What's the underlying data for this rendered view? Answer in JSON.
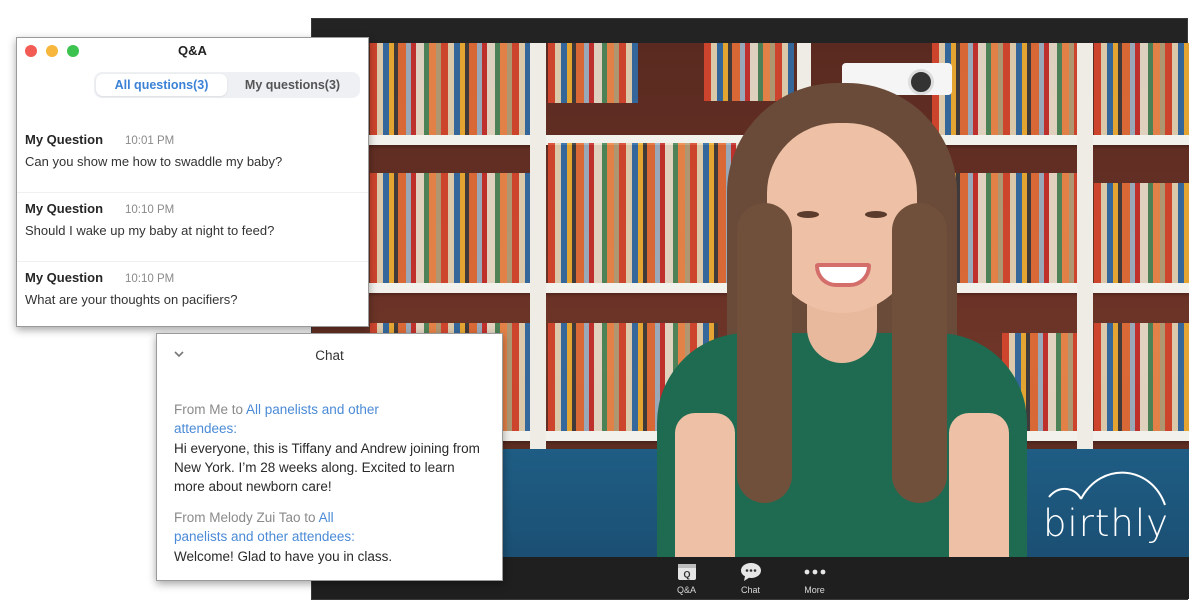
{
  "qa": {
    "title": "Q&A",
    "tabs": [
      {
        "label": "All questions(3)",
        "active": true
      },
      {
        "label": "My questions(3)",
        "active": false
      }
    ],
    "questions": [
      {
        "author": "My Question",
        "time": "10:01 PM",
        "text": "Can you show me how to swaddle my baby?"
      },
      {
        "author": "My Question",
        "time": "10:10 PM",
        "text": "Should I wake up my baby at night to feed?"
      },
      {
        "author": "My Question",
        "time": "10:10 PM",
        "text": "What are your thoughts on pacifiers?"
      }
    ]
  },
  "chat": {
    "title": "Chat",
    "collapse_icon": "chevron-down-icon",
    "messages": [
      {
        "from_prefix": "From Me to ",
        "recipient": "All panelists and other attendees:",
        "text": "Hi everyone, this is Tiffany and Andrew joining from New York. I’m 28 weeks along. Excited to learn more about newborn care!"
      },
      {
        "from_prefix": "From Melody Zui Tao to ",
        "recipient": "All panelists and other attendees:",
        "text": "Welcome! Glad to have you in class."
      }
    ]
  },
  "video": {
    "brand_name": "birthly",
    "toolbar": [
      {
        "label": "Q&A",
        "icon": "qa-icon"
      },
      {
        "label": "Chat",
        "icon": "chat-bubble-icon"
      },
      {
        "label": "More",
        "icon": "more-dots-icon"
      }
    ]
  },
  "colors": {
    "accent_blue": "#3b82d6",
    "link_blue": "#4a8ad6",
    "close": "#f25c54",
    "minimize": "#f6b73c",
    "maximize": "#3cc24f",
    "toolbar_bg": "#1f1f1f"
  }
}
